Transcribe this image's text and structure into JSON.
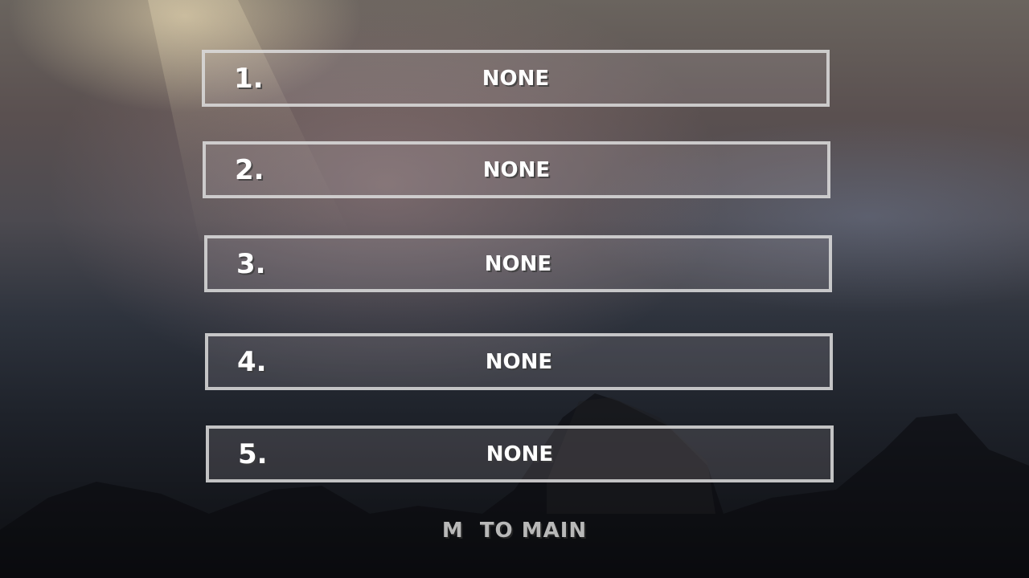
{
  "slots": [
    {
      "number": "1.",
      "name": "NONE"
    },
    {
      "number": "2.",
      "name": "NONE"
    },
    {
      "number": "3.",
      "name": "NONE"
    },
    {
      "number": "4.",
      "name": "NONE"
    },
    {
      "number": "5.",
      "name": "NONE"
    }
  ],
  "footer": {
    "back_label": "M  TO MAIN"
  },
  "colors": {
    "slot_border": "#dcdcdc",
    "text": "#ffffff",
    "footer_text": "#b8b8b8"
  }
}
